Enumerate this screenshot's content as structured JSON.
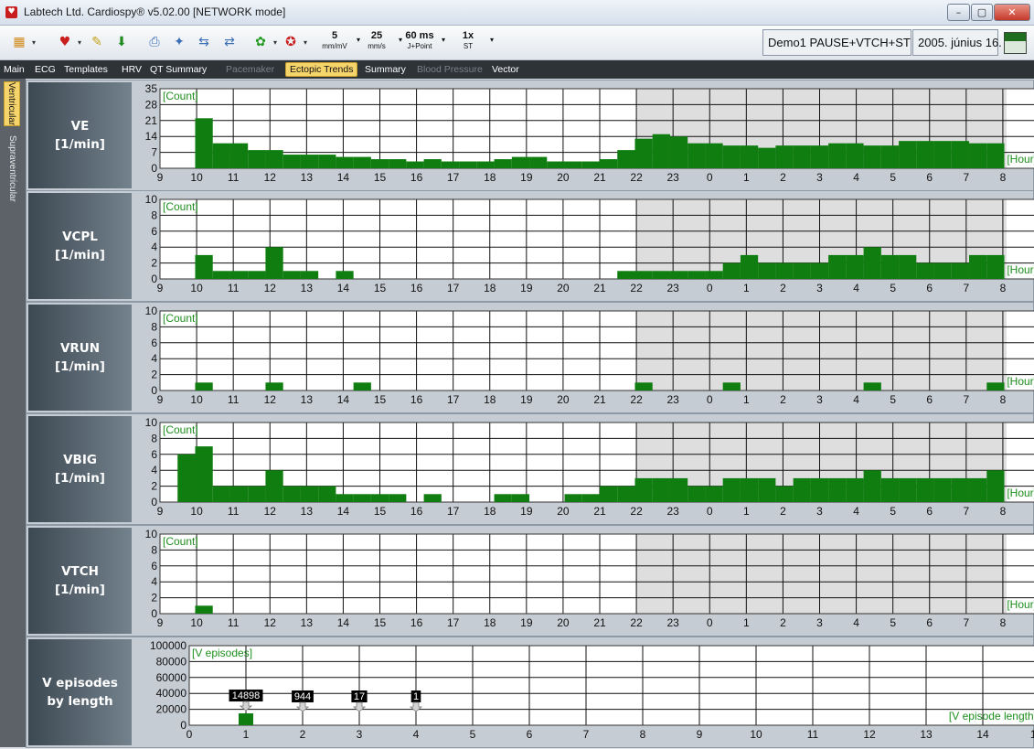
{
  "window": {
    "title": "Labtech Ltd. Cardiospy® v5.02.00 [NETWORK mode]",
    "controls": [
      "–",
      "▢",
      "✕"
    ]
  },
  "toolbar": {
    "icons": [
      {
        "name": "open-study-icon",
        "glyph": "▦",
        "color": "#d18a1a",
        "dropdown": true
      },
      {
        "name": "ecg-wave-icon",
        "glyph": "♥",
        "color": "#c81e1e",
        "dropdown": true
      },
      {
        "name": "edit-note-icon",
        "glyph": "✎",
        "color": "#c2a21a",
        "dropdown": false
      },
      {
        "name": "download-icon",
        "glyph": "⬇",
        "color": "#1f8a1f",
        "dropdown": false
      },
      {
        "name": "print-icon",
        "glyph": "⎙",
        "color": "#3b6fb5",
        "dropdown": false
      },
      {
        "name": "report-wizard-icon",
        "glyph": "✦",
        "color": "#3b6fb5",
        "dropdown": false
      },
      {
        "name": "export-icon",
        "glyph": "⇆",
        "color": "#3b6fb5",
        "dropdown": false
      },
      {
        "name": "import-icon",
        "glyph": "⇄",
        "color": "#3b6fb5",
        "dropdown": false
      },
      {
        "name": "green-tools-icon",
        "glyph": "✿",
        "color": "#1f9a1f",
        "dropdown": true
      },
      {
        "name": "red-tools-icon",
        "glyph": "✪",
        "color": "#c81e1e",
        "dropdown": true
      }
    ],
    "selectors": [
      {
        "name": "amplitude-selector",
        "value": "5",
        "unit": "mm/mV"
      },
      {
        "name": "paper-speed-selector",
        "value": "25",
        "unit": "mm/s"
      },
      {
        "name": "j-point-selector",
        "value": "60 ms",
        "unit": "J+Point"
      },
      {
        "name": "st-scale-selector",
        "value": "1x",
        "unit": "ST"
      }
    ],
    "status": "Demo1 PAUSE+VTCH+ST",
    "date": "2005. június 16."
  },
  "tabs": [
    {
      "label": "Main",
      "state": "normal"
    },
    {
      "label": "ECG",
      "state": "normal"
    },
    {
      "label": "Templates",
      "state": "normal"
    },
    {
      "label": "HRV",
      "state": "normal"
    },
    {
      "label": "QT Summary",
      "state": "normal"
    },
    {
      "label": "Pacemaker",
      "state": "disabled"
    },
    {
      "label": "Ectopic Trends",
      "state": "active"
    },
    {
      "label": "Summary",
      "state": "normal"
    },
    {
      "label": "Blood Pressure",
      "state": "disabled"
    },
    {
      "label": "Vector",
      "state": "normal"
    }
  ],
  "side_tabs": [
    {
      "label": "Ventricular",
      "state": "active"
    },
    {
      "label": "Supraventricular",
      "state": "inactive"
    }
  ],
  "colors": {
    "bar": "#0f7d0f",
    "night_shade": "#dedede",
    "grid": "#111111",
    "overlay_text": "#1e8f1e"
  },
  "chart_data": [
    {
      "type": "bar",
      "label_lines": [
        "VE",
        "[1/min]"
      ],
      "y_label": "[Count]",
      "x_label": "[Hour]",
      "ylim": [
        0,
        35
      ],
      "y_ticks": [
        "0",
        "7",
        "14",
        "21",
        "28",
        "35"
      ],
      "x_ticks": [
        "9",
        "10",
        "11",
        "12",
        "13",
        "14",
        "15",
        "16",
        "17",
        "18",
        "19",
        "20",
        "21",
        "22",
        "23",
        "0",
        "1",
        "2",
        "3",
        "4",
        "5",
        "6",
        "7",
        "8",
        "9"
      ],
      "night_shade_hours": [
        22,
        8.1
      ],
      "hourly_values": [
        0,
        0,
        22,
        11,
        11,
        8,
        8,
        6,
        6,
        6,
        5,
        5,
        4,
        4,
        3,
        4,
        3,
        3,
        3,
        4,
        5,
        5,
        3,
        3,
        3,
        4,
        8,
        13,
        15,
        14,
        11,
        11,
        10,
        10,
        9,
        10,
        10,
        10,
        11,
        11,
        10,
        10,
        12,
        12,
        12,
        12,
        11,
        11,
        0,
        0
      ]
    },
    {
      "type": "bar",
      "label_lines": [
        "VCPL",
        "[1/min]"
      ],
      "y_label": "[Count]",
      "x_label": "[Hour]",
      "ylim": [
        0,
        10
      ],
      "y_ticks": [
        "0",
        "2",
        "4",
        "6",
        "8",
        "10"
      ],
      "x_ticks": [
        "9",
        "10",
        "11",
        "12",
        "13",
        "14",
        "15",
        "16",
        "17",
        "18",
        "19",
        "20",
        "21",
        "22",
        "23",
        "0",
        "1",
        "2",
        "3",
        "4",
        "5",
        "6",
        "7",
        "8",
        "9"
      ],
      "night_shade_hours": [
        22,
        8.1
      ],
      "hourly_values": [
        0,
        0,
        3,
        1,
        1,
        1,
        4,
        1,
        1,
        0,
        1,
        0,
        0,
        0,
        0,
        0,
        0,
        0,
        0,
        0,
        0,
        0,
        0,
        0,
        0,
        0,
        1,
        1,
        1,
        1,
        1,
        1,
        2,
        3,
        2,
        2,
        2,
        2,
        3,
        3,
        4,
        3,
        3,
        2,
        2,
        2,
        3,
        3,
        0,
        0
      ]
    },
    {
      "type": "bar",
      "label_lines": [
        "VRUN",
        "[1/min]"
      ],
      "y_label": "[Count]",
      "x_label": "[Hour]",
      "ylim": [
        0,
        10
      ],
      "y_ticks": [
        "0",
        "2",
        "4",
        "6",
        "8",
        "10"
      ],
      "x_ticks": [
        "9",
        "10",
        "11",
        "12",
        "13",
        "14",
        "15",
        "16",
        "17",
        "18",
        "19",
        "20",
        "21",
        "22",
        "23",
        "0",
        "1",
        "2",
        "3",
        "4",
        "5",
        "6",
        "7",
        "8",
        "9"
      ],
      "night_shade_hours": [
        22,
        8.1
      ],
      "hourly_values": [
        0,
        0,
        1,
        0,
        0,
        0,
        1,
        0,
        0,
        0,
        0,
        1,
        0,
        0,
        0,
        0,
        0,
        0,
        0,
        0,
        0,
        0,
        0,
        0,
        0,
        0,
        0,
        1,
        0,
        0,
        0,
        0,
        1,
        0,
        0,
        0,
        0,
        0,
        0,
        0,
        1,
        0,
        0,
        0,
        0,
        0,
        0,
        1,
        0,
        0
      ]
    },
    {
      "type": "bar",
      "label_lines": [
        "VBIG",
        "[1/min]"
      ],
      "y_label": "[Count]",
      "x_label": "[Hour]",
      "ylim": [
        0,
        10
      ],
      "y_ticks": [
        "0",
        "2",
        "4",
        "6",
        "8",
        "10"
      ],
      "x_ticks": [
        "9",
        "10",
        "11",
        "12",
        "13",
        "14",
        "15",
        "16",
        "17",
        "18",
        "19",
        "20",
        "21",
        "22",
        "23",
        "0",
        "1",
        "2",
        "3",
        "4",
        "5",
        "6",
        "7",
        "8",
        "9"
      ],
      "night_shade_hours": [
        22,
        8.1
      ],
      "hourly_values": [
        0,
        6,
        7,
        2,
        2,
        2,
        4,
        2,
        2,
        2,
        1,
        1,
        1,
        1,
        0,
        1,
        0,
        0,
        0,
        1,
        1,
        0,
        0,
        1,
        1,
        2,
        2,
        3,
        3,
        3,
        2,
        2,
        3,
        3,
        3,
        2,
        3,
        3,
        3,
        3,
        4,
        3,
        3,
        3,
        3,
        3,
        3,
        4,
        0,
        0
      ]
    },
    {
      "type": "bar",
      "label_lines": [
        "VTCH",
        "[1/min]"
      ],
      "y_label": "[Count]",
      "x_label": "[Hour]",
      "ylim": [
        0,
        10
      ],
      "y_ticks": [
        "0",
        "2",
        "4",
        "6",
        "8",
        "10"
      ],
      "x_ticks": [
        "9",
        "10",
        "11",
        "12",
        "13",
        "14",
        "15",
        "16",
        "17",
        "18",
        "19",
        "20",
        "21",
        "22",
        "23",
        "0",
        "1",
        "2",
        "3",
        "4",
        "5",
        "6",
        "7",
        "8",
        "9"
      ],
      "night_shade_hours": [
        22,
        8.1
      ],
      "hourly_values": [
        0,
        0,
        1,
        0,
        0,
        0,
        0,
        0,
        0,
        0,
        0,
        0,
        0,
        0,
        0,
        0,
        0,
        0,
        0,
        0,
        0,
        0,
        0,
        0,
        0,
        0,
        0,
        0,
        0,
        0,
        0,
        0,
        0,
        0,
        0,
        0,
        0,
        0,
        0,
        0,
        0,
        0,
        0,
        0,
        0,
        0,
        0,
        0,
        0,
        0
      ]
    },
    {
      "type": "bar",
      "label_lines": [
        "V episodes",
        "by length"
      ],
      "y_label": "[V episodes]",
      "x_label": "[V episode length]",
      "ylim": [
        0,
        100000
      ],
      "y_ticks": [
        "0",
        "20000",
        "40000",
        "60000",
        "80000",
        "100000"
      ],
      "x_ticks": [
        "0",
        "1",
        "2",
        "3",
        "4",
        "5",
        "6",
        "7",
        "8",
        "9",
        "10",
        "11",
        "12",
        "13",
        "14",
        "15<"
      ],
      "episodes": [
        {
          "length": 1,
          "count": 14898,
          "label": "14898"
        },
        {
          "length": 2,
          "count": 944,
          "label": "944"
        },
        {
          "length": 3,
          "count": 17,
          "label": "17"
        },
        {
          "length": 4,
          "count": 1,
          "label": "1"
        }
      ]
    }
  ]
}
